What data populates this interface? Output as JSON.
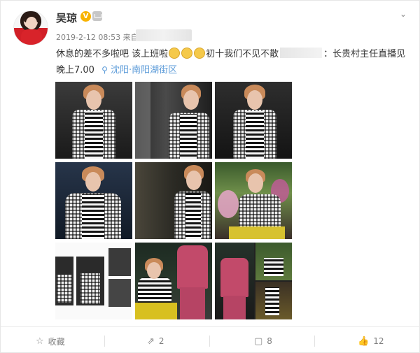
{
  "user": {
    "name": "吴琼",
    "verified_badge": "V"
  },
  "post": {
    "timestamp": "2019-2-12 08:53",
    "source_prefix": "来自",
    "text_part1": "休息的差不多啦吧 该上班啦",
    "text_part2": "初十我们不见不散",
    "text_part3": "：长贵村主任直播见 晚上7.00",
    "location": "沈阳·南阳湖街区"
  },
  "icons": {
    "chevron": "chevron-down-icon",
    "location": "location-pin-icon",
    "favorite": "star-icon",
    "repost": "repost-icon",
    "comment": "comment-icon",
    "like": "thumbs-up-icon"
  },
  "actions": {
    "favorite_label": "收藏",
    "repost_count": "2",
    "comment_count": "8",
    "like_count": "12"
  },
  "colors": {
    "link": "#5a9ad8",
    "verified": "#f8b300"
  }
}
